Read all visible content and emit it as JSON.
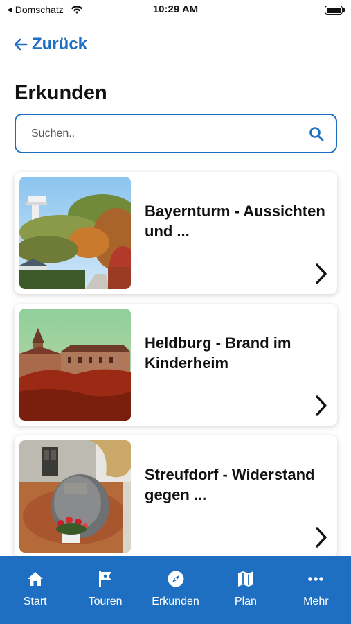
{
  "status_bar": {
    "carrier": "Domschatz",
    "time": "10:29 AM"
  },
  "header": {
    "back_label": "Zurück",
    "title": "Erkunden"
  },
  "search": {
    "placeholder": "Suchen.."
  },
  "items": [
    {
      "title": "Bayernturm - Aussichten und ..."
    },
    {
      "title": "Heldburg - Brand im Kinderheim"
    },
    {
      "title": "Streufdorf - Widerstand gegen ..."
    }
  ],
  "tab_bar": {
    "tabs": [
      {
        "label": "Start",
        "icon": "home-icon"
      },
      {
        "label": "Touren",
        "icon": "flag-icon"
      },
      {
        "label": "Erkunden",
        "icon": "compass-icon"
      },
      {
        "label": "Plan",
        "icon": "map-icon"
      },
      {
        "label": "Mehr",
        "icon": "more-icon"
      }
    ]
  },
  "colors": {
    "accent": "#1e6ec1",
    "tab_bar_bg": "#1e6ec1"
  }
}
